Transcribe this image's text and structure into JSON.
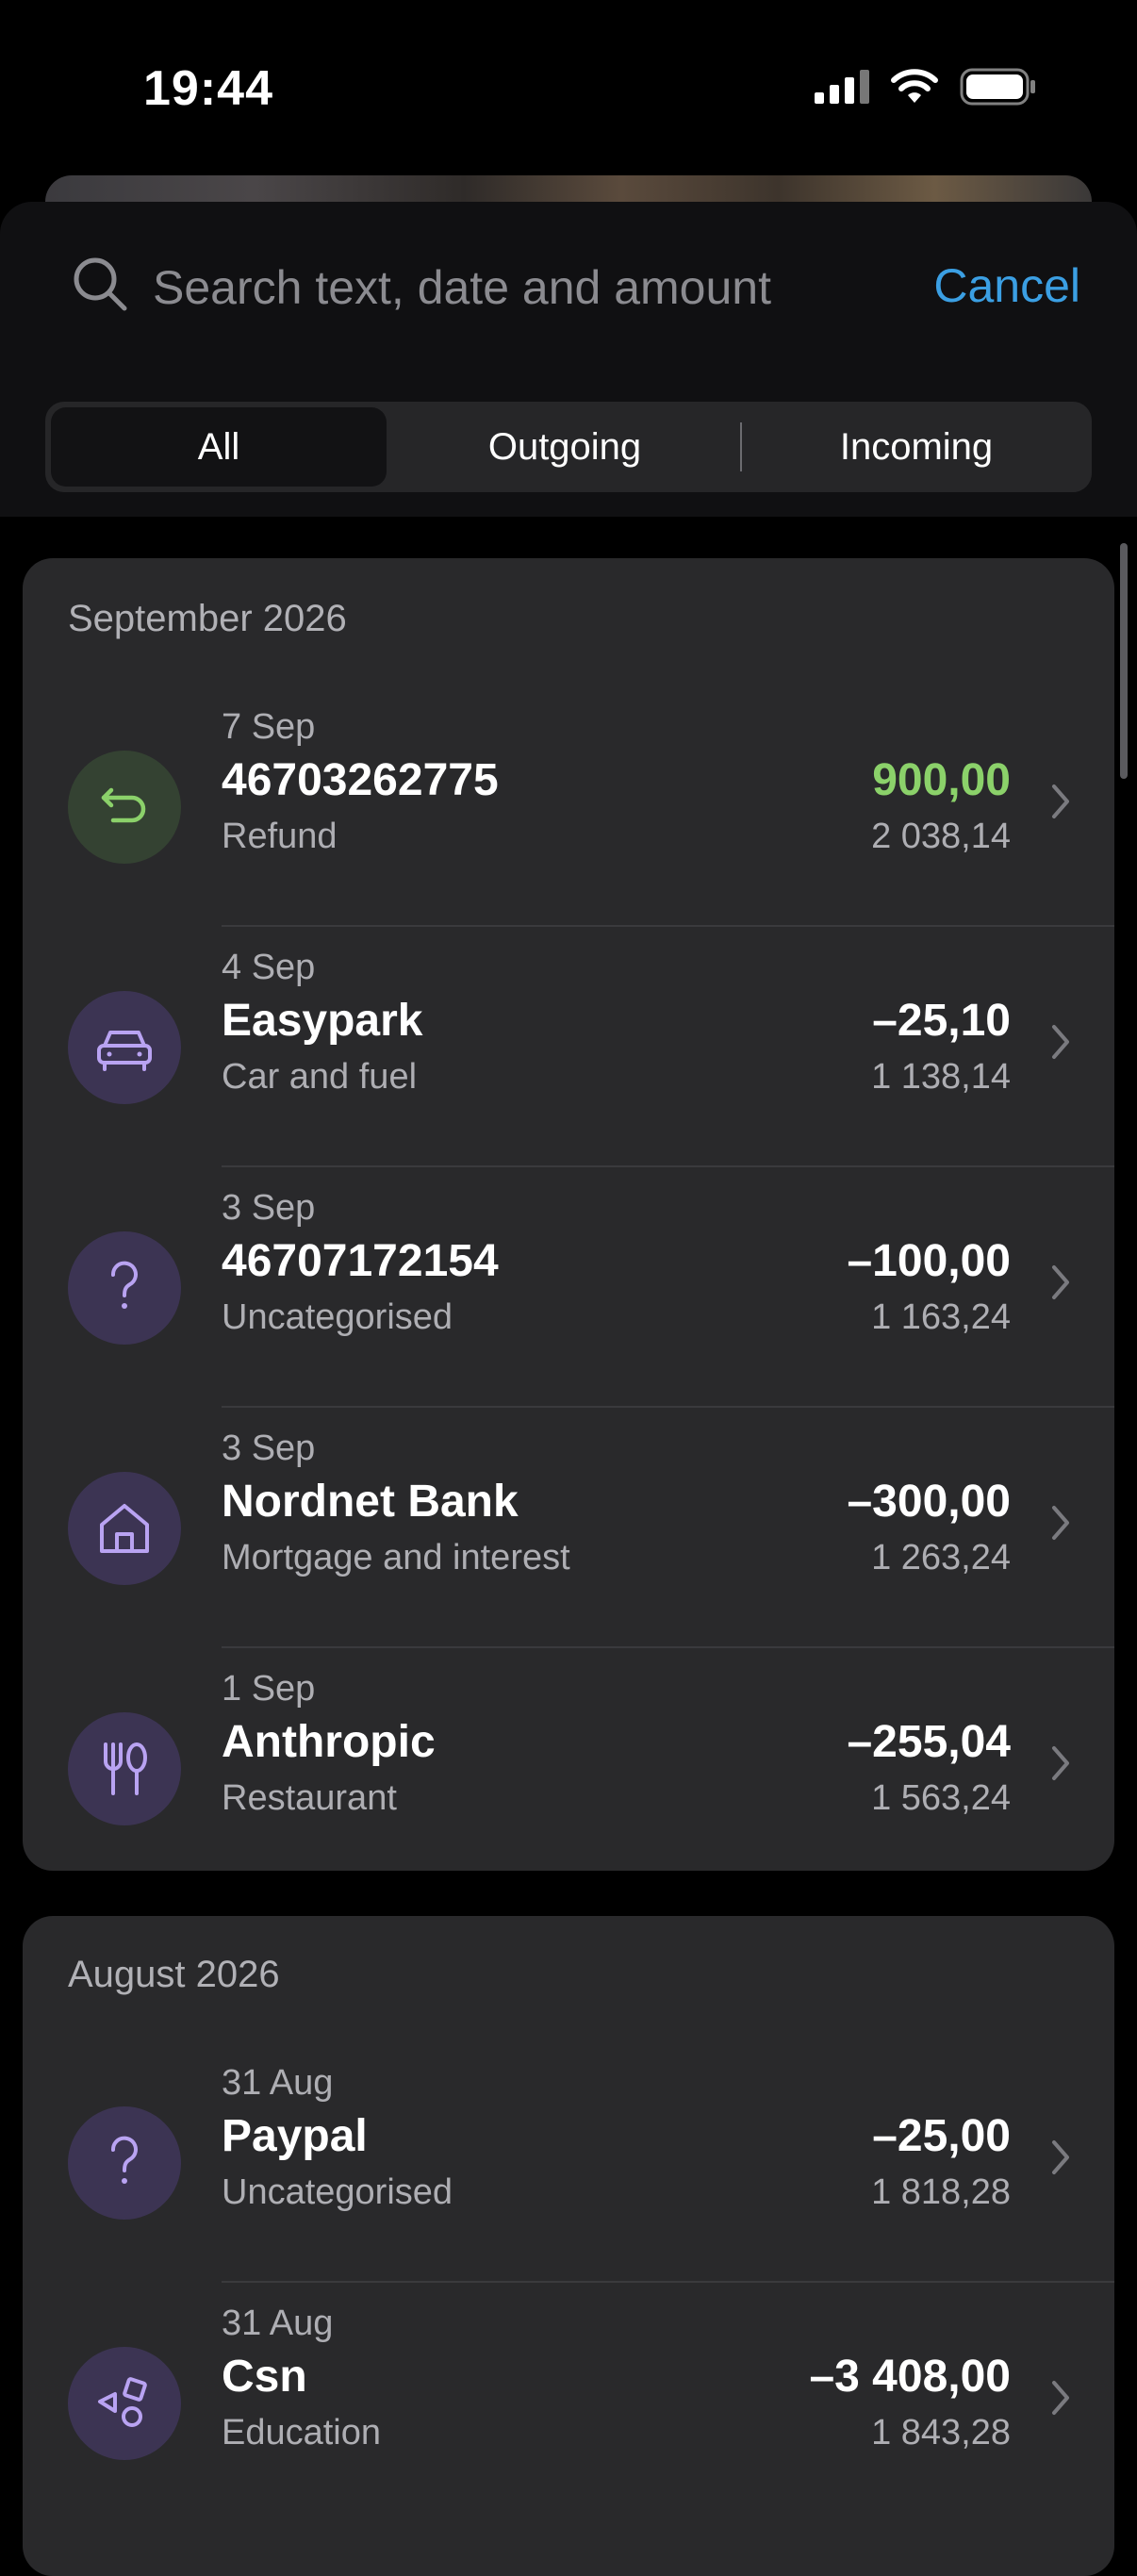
{
  "status_bar": {
    "time": "19:44"
  },
  "search": {
    "placeholder": "Search text, date and amount",
    "cancel_label": "Cancel"
  },
  "filter_tabs": [
    {
      "label": "All",
      "active": true
    },
    {
      "label": "Outgoing",
      "active": false
    },
    {
      "label": "Incoming",
      "active": false
    }
  ],
  "groups": [
    {
      "title": "September 2026",
      "transactions": [
        {
          "date": "7 Sep",
          "name": "46703262775",
          "category": "Refund",
          "amount": "900,00",
          "balance": "2 038,14",
          "icon": "refund-icon",
          "positive": true
        },
        {
          "date": "4 Sep",
          "name": "Easypark",
          "category": "Car and fuel",
          "amount": "–25,10",
          "balance": "1 138,14",
          "icon": "car-icon",
          "positive": false
        },
        {
          "date": "3 Sep",
          "name": "46707172154",
          "category": "Uncategorised",
          "amount": "–100,00",
          "balance": "1 163,24",
          "icon": "question-icon",
          "positive": false
        },
        {
          "date": "3 Sep",
          "name": "Nordnet Bank",
          "category": "Mortgage and interest",
          "amount": "–300,00",
          "balance": "1 263,24",
          "icon": "house-icon",
          "positive": false
        },
        {
          "date": "1 Sep",
          "name": "Anthropic",
          "category": "Restaurant",
          "amount": "–255,04",
          "balance": "1 563,24",
          "icon": "cutlery-icon",
          "positive": false
        }
      ]
    },
    {
      "title": "August 2026",
      "transactions": [
        {
          "date": "31 Aug",
          "name": "Paypal",
          "category": "Uncategorised",
          "amount": "–25,00",
          "balance": "1 818,28",
          "icon": "question-icon",
          "positive": false
        },
        {
          "date": "31 Aug",
          "name": "Csn",
          "category": "Education",
          "amount": "–3 408,00",
          "balance": "1 843,28",
          "icon": "shapes-icon",
          "positive": false
        }
      ]
    }
  ],
  "colors": {
    "accent": "#3b9fe3",
    "positive": "#8bd16a",
    "icon_purple": "#b9a3f2",
    "icon_bg_purple": "#3c3453",
    "icon_bg_green": "#344232"
  }
}
